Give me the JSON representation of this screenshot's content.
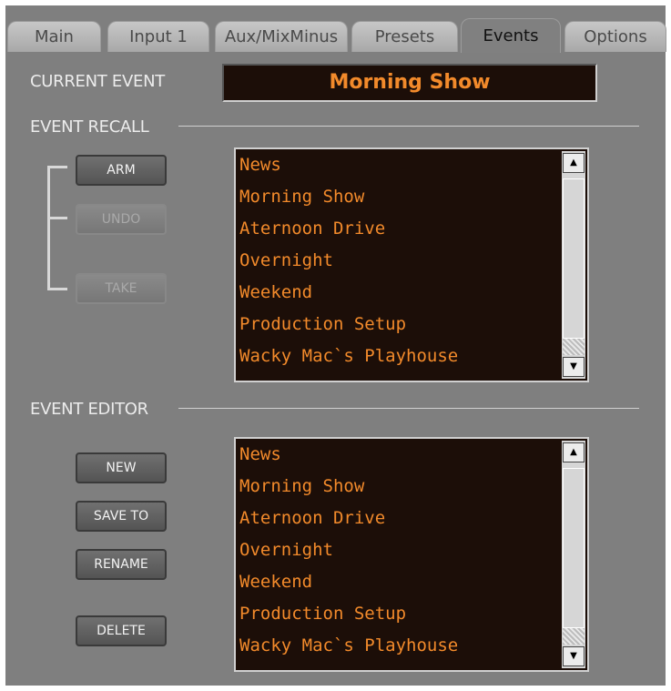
{
  "tabs": [
    {
      "label": "Main"
    },
    {
      "label": "Input 1"
    },
    {
      "label": "Aux/MixMinus"
    },
    {
      "label": "Presets"
    },
    {
      "label": "Events"
    },
    {
      "label": "Options"
    }
  ],
  "active_tab": "Events",
  "current_event": {
    "label": "CURRENT EVENT",
    "value": "Morning Show"
  },
  "event_recall": {
    "title": "EVENT RECALL",
    "buttons": {
      "arm": "ARM",
      "undo": "UNDO",
      "take": "TAKE"
    },
    "items": [
      "News",
      "Morning Show",
      "Aternoon Drive",
      "Overnight",
      "Weekend",
      "Production Setup",
      "Wacky Mac`s Playhouse"
    ]
  },
  "event_editor": {
    "title": "EVENT EDITOR",
    "buttons": {
      "new": "NEW",
      "save_to": "SAVE TO",
      "rename": "RENAME",
      "delete": "DELETE"
    },
    "items": [
      "News",
      "Morning Show",
      "Aternoon Drive",
      "Overnight",
      "Weekend",
      "Production Setup",
      "Wacky Mac`s Playhouse"
    ]
  },
  "colors": {
    "accent": "#f28a2b",
    "list_bg": "#1c0e08",
    "panel_bg": "#7f7f7f"
  },
  "icons": {
    "scroll_up": "triangle-up-icon",
    "scroll_down": "triangle-down-icon"
  }
}
